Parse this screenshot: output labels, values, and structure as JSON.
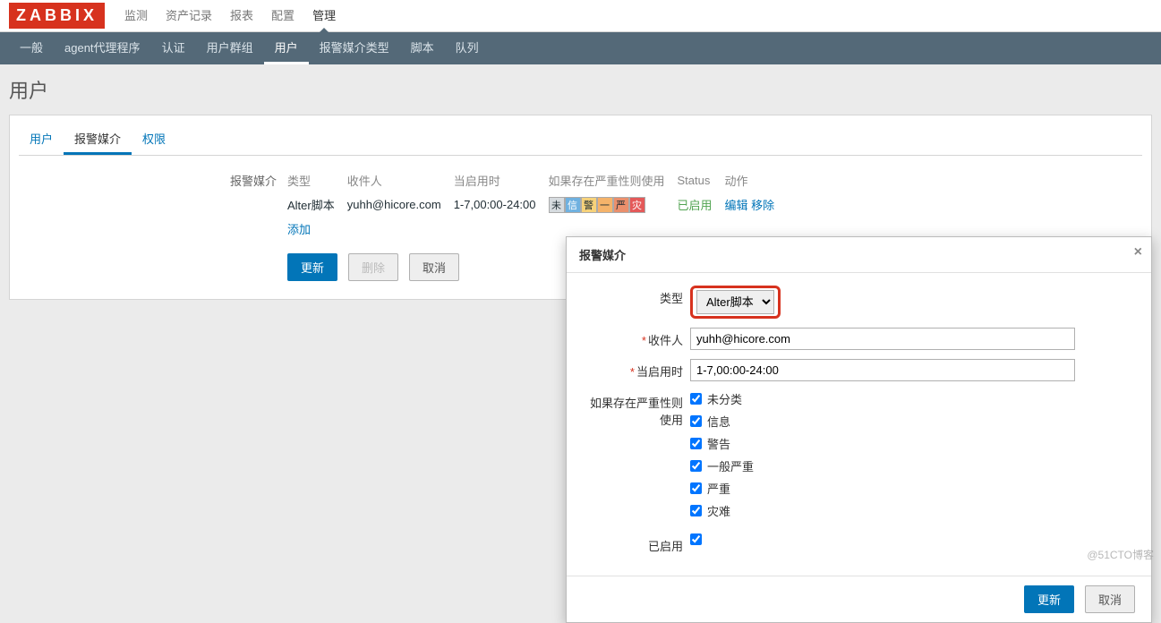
{
  "app": {
    "logo": "ZABBIX"
  },
  "topnav": {
    "items": [
      "监测",
      "资产记录",
      "报表",
      "配置",
      "管理"
    ],
    "active": 4
  },
  "subnav": {
    "items": [
      "一般",
      "agent代理程序",
      "认证",
      "用户群组",
      "用户",
      "报警媒介类型",
      "脚本",
      "队列"
    ],
    "active": 4
  },
  "page": {
    "title": "用户"
  },
  "tabs": {
    "items": [
      "用户",
      "报警媒介",
      "权限"
    ],
    "active": 1
  },
  "media_section": {
    "label": "报警媒介"
  },
  "media_table": {
    "headers": [
      "类型",
      "收件人",
      "当启用时",
      "如果存在严重性则使用",
      "Status",
      "动作"
    ],
    "rows": [
      {
        "type": "Alter脚本",
        "recipient": "yuhh@hicore.com",
        "when": "1-7,00:00-24:00",
        "severities": [
          "未",
          "信",
          "警",
          "一",
          "严",
          "灾"
        ],
        "status": "已启用",
        "actions": [
          "编辑",
          "移除"
        ]
      }
    ],
    "add": "添加"
  },
  "buttons": {
    "update": "更新",
    "delete": "删除",
    "cancel": "取消"
  },
  "modal": {
    "title": "报警媒介",
    "labels": {
      "type": "类型",
      "recipient": "收件人",
      "when": "当启用时",
      "severity": "如果存在严重性则使用",
      "enabled": "已启用"
    },
    "type_value": "Alter脚本",
    "recipient_value": "yuhh@hicore.com",
    "when_value": "1-7,00:00-24:00",
    "severity_options": [
      "未分类",
      "信息",
      "警告",
      "一般严重",
      "严重",
      "灾难"
    ],
    "enabled_checked": true,
    "buttons": {
      "update": "更新",
      "cancel": "取消"
    }
  },
  "watermark": "@51CTO博客"
}
